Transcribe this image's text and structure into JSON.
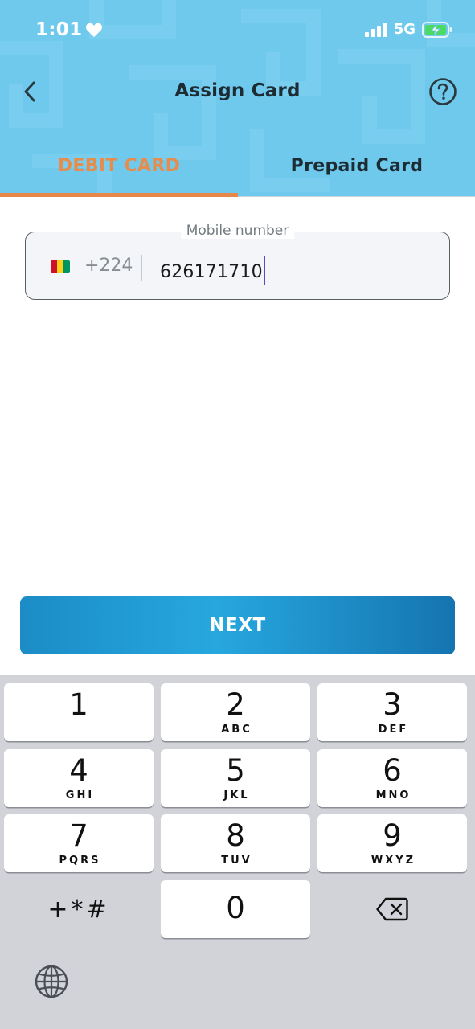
{
  "status_bar": {
    "time": "1:01",
    "network": "5G"
  },
  "header": {
    "title": "Assign Card"
  },
  "tabs": [
    {
      "label": "DEBIT CARD",
      "active": true
    },
    {
      "label": "Prepaid Card",
      "active": false
    }
  ],
  "phone_field": {
    "label": "Mobile number",
    "country_code": "+224",
    "value": "626171710"
  },
  "next_button": {
    "label": "NEXT"
  },
  "keyboard": {
    "keys": [
      {
        "digit": "1",
        "letters": ""
      },
      {
        "digit": "2",
        "letters": "ABC"
      },
      {
        "digit": "3",
        "letters": "DEF"
      },
      {
        "digit": "4",
        "letters": "GHI"
      },
      {
        "digit": "5",
        "letters": "JKL"
      },
      {
        "digit": "6",
        "letters": "MNO"
      },
      {
        "digit": "7",
        "letters": "PQRS"
      },
      {
        "digit": "8",
        "letters": "TUV"
      },
      {
        "digit": "9",
        "letters": "WXYZ"
      },
      {
        "digit": "0",
        "letters": ""
      }
    ],
    "symbols": "+*#"
  },
  "colors": {
    "header_bg": "#6ec9ec",
    "active_tab": "#e68d4e",
    "button_blue": "#1b8cc6",
    "caret": "#6543c8"
  }
}
